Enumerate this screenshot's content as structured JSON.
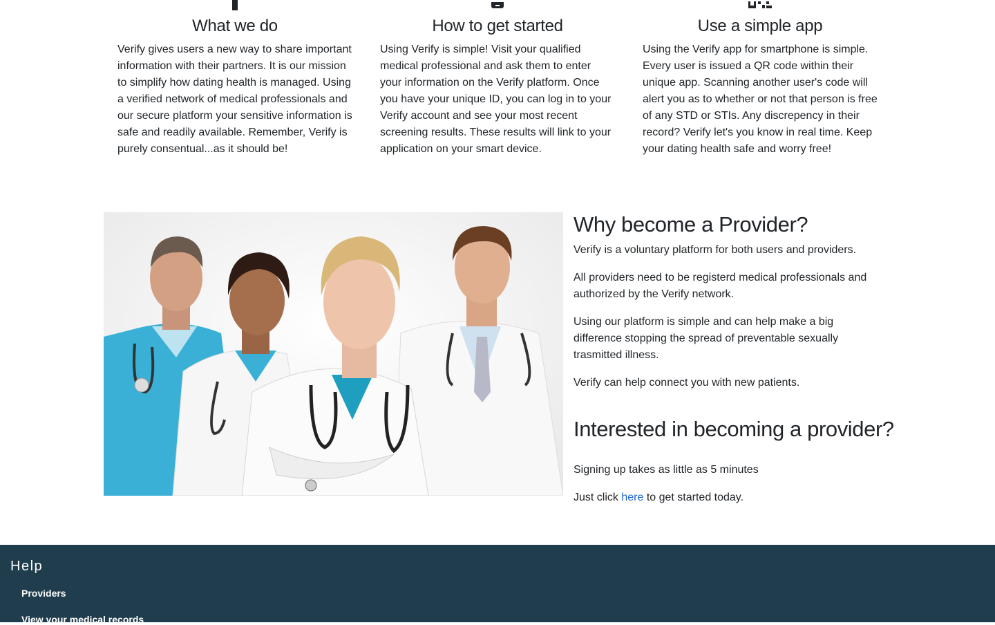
{
  "features": [
    {
      "icon": "person-icon",
      "title": "What we do",
      "text": "Verify gives users a new way to share important information with their partners. It is our mission to simplify how dating health is managed. Using a verified network of medical professionals and our secure platform your sensitive information is safe and readily available. Remember, Verify is purely consentual...as it should be!"
    },
    {
      "icon": "mobile-phone-icon",
      "title": "How to get started",
      "text": "Using Verify is simple! Visit your qualified medical professional and ask them to enter your information on the Verify platform. Once you have your unique ID, you can log in to your Verify account and see your most recent screening results. These results will link to your application on your smart device."
    },
    {
      "icon": "qr-code-icon",
      "title": "Use a simple app",
      "text": "Using the Verify app for smartphone is simple. Every user is issued a QR code within their unique app. Scanning another user's code will alert you as to whether or not that person is free of any STD or STIs. Any discrepency in their record? Verify let's you know in real time. Keep your dating health safe and worry free!"
    }
  ],
  "provider": {
    "image": "doctors-group-photo",
    "heading": "Why become a Provider?",
    "p1": "Verify is a voluntary platform for both users and providers.",
    "p2": "All providers need to be registerd medical professionals and authorized by the Verify network.",
    "p3": "Using our platform is simple and can help make a big difference stopping the spread of preventable sexually trasmitted illness.",
    "p4": "Verify can help connect you with new patients.",
    "heading2": "Interested in becoming a provider?",
    "p5": "Signing up takes as little as 5 minutes",
    "p6_before": "Just click ",
    "p6_link": "here",
    "p6_after": " to get started today."
  },
  "footer": {
    "heading": "Help",
    "links": [
      "Providers",
      "View your medical records"
    ]
  },
  "colors": {
    "footer_bg": "#1f3d4c",
    "link": "#1a63d8",
    "scrubs_teal": "#3ab0d6"
  }
}
